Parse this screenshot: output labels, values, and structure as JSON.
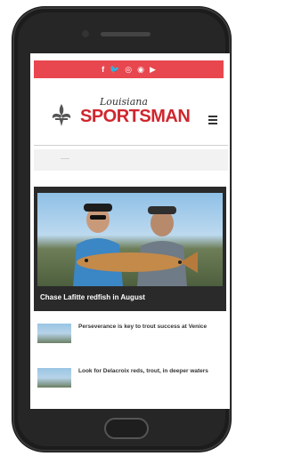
{
  "social": {
    "icons": [
      "facebook-icon",
      "twitter-icon",
      "instagram-icon",
      "pinterest-icon",
      "youtube-icon"
    ],
    "glyphs": [
      "f",
      "🐦",
      "◎",
      "◉",
      "▶"
    ],
    "color": "#e8474f"
  },
  "brand": {
    "script_text": "Louisiana",
    "name": "SPORTSMAN",
    "color": "#d0262e"
  },
  "hero": {
    "caption": "Chase Lafitte redfish in August"
  },
  "articles": [
    {
      "title": "Perseverance is key to trout success at Venice",
      "date": ""
    },
    {
      "title": "Look for Delacroix reds, trout, in deeper waters",
      "date": ""
    }
  ]
}
